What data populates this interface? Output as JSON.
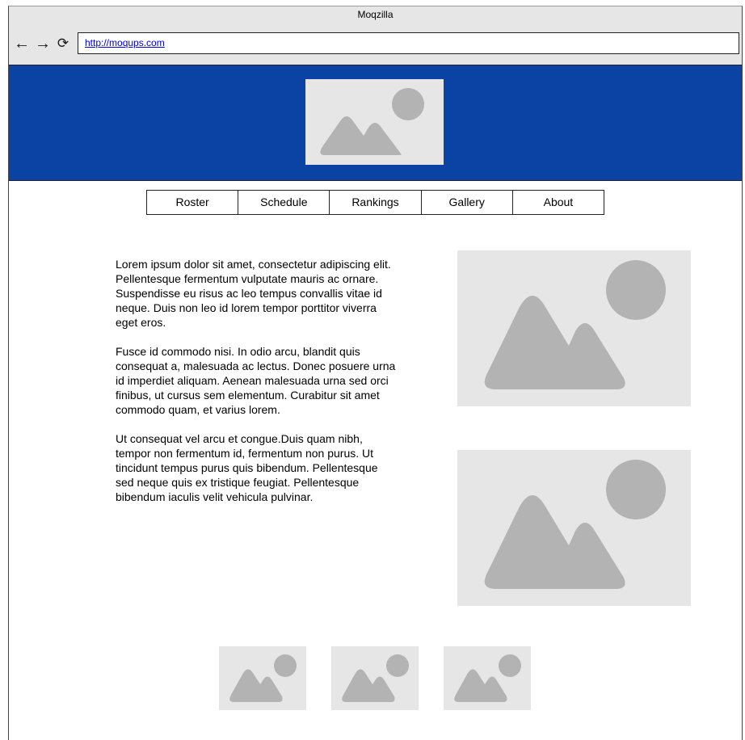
{
  "window": {
    "title": "Moqzilla"
  },
  "toolbar": {
    "back_icon": "←",
    "forward_icon": "→",
    "reload_icon": "⟳",
    "url": "http://moqups.com"
  },
  "nav": {
    "items": [
      {
        "label": "Roster"
      },
      {
        "label": "Schedule"
      },
      {
        "label": "Rankings"
      },
      {
        "label": "Gallery"
      },
      {
        "label": "About"
      }
    ]
  },
  "content": {
    "paragraphs": [
      "Lorem ipsum dolor sit amet, consectetur adipiscing elit. Pellentesque fermentum vulputate mauris ac ornare. Suspendisse eu risus ac leo tempus convallis vitae id neque. Duis non leo id lorem tempor porttitor viverra eget eros.",
      "Fusce id commodo nisi. In odio arcu, blandit quis consequat a, malesuada ac lectus. Donec posuere urna id imperdiet aliquam. Aenean malesuada urna sed orci finibus, ut cursus sem elementum. Curabitur sit amet commodo quam, et varius lorem.",
      "Ut consequat vel arcu et congue.Duis quam nibh, tempor non fermentum id, fermentum non purus. Ut tincidunt tempus purus quis bibendum. Pellentesque sed neque quis ex tristique feugiat. Pellentesque bibendum iaculis velit vehicula pulvinar."
    ]
  },
  "colors": {
    "header_blue": "#0a43a3",
    "placeholder_bg": "#e6e6e6",
    "placeholder_shape": "#b3b3b3"
  },
  "icons": {
    "image_placeholder": "image-placeholder-icon"
  }
}
